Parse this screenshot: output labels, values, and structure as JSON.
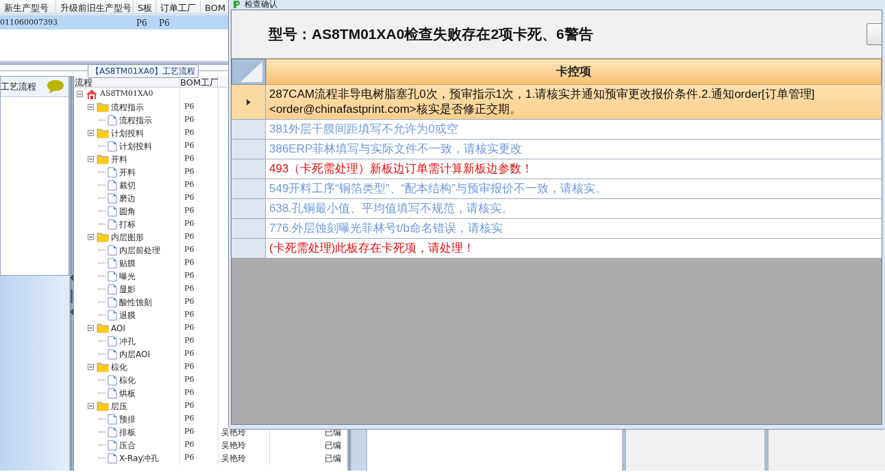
{
  "top_grid": {
    "columns": [
      "新生产型号",
      "升级前旧生产型号",
      "S板",
      "订单工厂",
      "BOM"
    ],
    "rows": [
      {
        "cells": [
          "011060007393",
          "",
          "P6",
          "P6",
          ""
        ],
        "selected": true
      }
    ]
  },
  "flow_panel": {
    "caption": "【AS8TM01XA0】工艺流程"
  },
  "left_panel": {
    "title": "工艺流程"
  },
  "tree_grid": {
    "columns": [
      "流程",
      "BOM工厂"
    ],
    "tree": [
      {
        "label": "AS8TM01XA0",
        "kind": "root",
        "expanded": true,
        "children": [
          {
            "label": "流程指示",
            "bom": "P6",
            "expanded": true,
            "children": [
              {
                "label": "流程指示",
                "bom": "P6"
              }
            ]
          },
          {
            "label": "计划投料",
            "bom": "P6",
            "expanded": true,
            "children": [
              {
                "label": "计划投料",
                "bom": "P6"
              }
            ]
          },
          {
            "label": "开料",
            "bom": "P6",
            "expanded": true,
            "children": [
              {
                "label": "开料",
                "bom": "P6"
              },
              {
                "label": "裁切",
                "bom": "P6"
              },
              {
                "label": "磨边",
                "bom": "P6"
              },
              {
                "label": "圆角",
                "bom": "P6"
              },
              {
                "label": "打标",
                "bom": "P6"
              }
            ]
          },
          {
            "label": "内层图形",
            "bom": "P6",
            "expanded": true,
            "children": [
              {
                "label": "内层前处理",
                "bom": "P6"
              },
              {
                "label": "贴膜",
                "bom": "P6"
              },
              {
                "label": "曝光",
                "bom": "P6"
              },
              {
                "label": "显影",
                "bom": "P6"
              },
              {
                "label": "酸性蚀刻",
                "bom": "P6"
              },
              {
                "label": "退膜",
                "bom": "P6"
              }
            ]
          },
          {
            "label": "AOI",
            "bom": "P6",
            "expanded": true,
            "children": [
              {
                "label": "冲孔",
                "bom": "P6"
              },
              {
                "label": "内层AOI",
                "bom": "P6"
              }
            ]
          },
          {
            "label": "棕化",
            "bom": "P6",
            "expanded": true,
            "children": [
              {
                "label": "棕化",
                "bom": "P6"
              },
              {
                "label": "烘板",
                "bom": "P6"
              }
            ]
          },
          {
            "label": "层压",
            "bom": "P6",
            "expanded": true,
            "children": [
              {
                "label": "预排",
                "bom": "P6"
              },
              {
                "label": "排板",
                "bom": "P6",
                "column_3": "吴艳玲",
                "column_5": "已编"
              },
              {
                "label": "压合",
                "bom": "P6",
                "column_3": "吴艳玲",
                "column_5": "已编"
              },
              {
                "label": "X-Ray冲孔",
                "bom": "P6",
                "column_3": "吴艳玲",
                "column_5": "已编"
              }
            ]
          }
        ]
      }
    ]
  },
  "dialog": {
    "window_title": "检查确认",
    "heading": "型号：AS8TM01XA0检查失败存在2项卡死、6警告",
    "table": {
      "column": "卡控项",
      "rows": [
        {
          "lines": [
            "287CAM流程非导电树脂塞孔0次，预审指示1次，1.请核实并通知预审更改报价条件.2.通知order[订单管理]",
            "<order@chinafastprint.com>核实是否修正交期。"
          ],
          "kind": "warning",
          "selected": true
        },
        {
          "lines": [
            "381外层干膜间距填写不允许为0或空"
          ],
          "kind": "warning",
          "selected": false
        },
        {
          "lines": [
            "386ERP菲林填写与实际文件不一致，请核实更改"
          ],
          "kind": "warning",
          "selected": false
        },
        {
          "lines": [
            "493（卡死需处理）新板边订单需计算新板边参数！"
          ],
          "kind": "block",
          "selected": false
        },
        {
          "lines": [
            "549开料工序“铜箔类型”、“配本结构”与预审报价不一致，请核实。"
          ],
          "kind": "warning",
          "selected": false
        },
        {
          "lines": [
            "638.孔铜最小值、平均值填写不规范，请核实。"
          ],
          "kind": "warning",
          "selected": false
        },
        {
          "lines": [
            "776.外层蚀刻曝光菲林号t/b命名错误，请核实"
          ],
          "kind": "warning",
          "selected": false
        },
        {
          "lines": [
            "(卡死需处理)此板存在卡死项，请处理！"
          ],
          "kind": "block",
          "selected": false
        }
      ]
    }
  }
}
